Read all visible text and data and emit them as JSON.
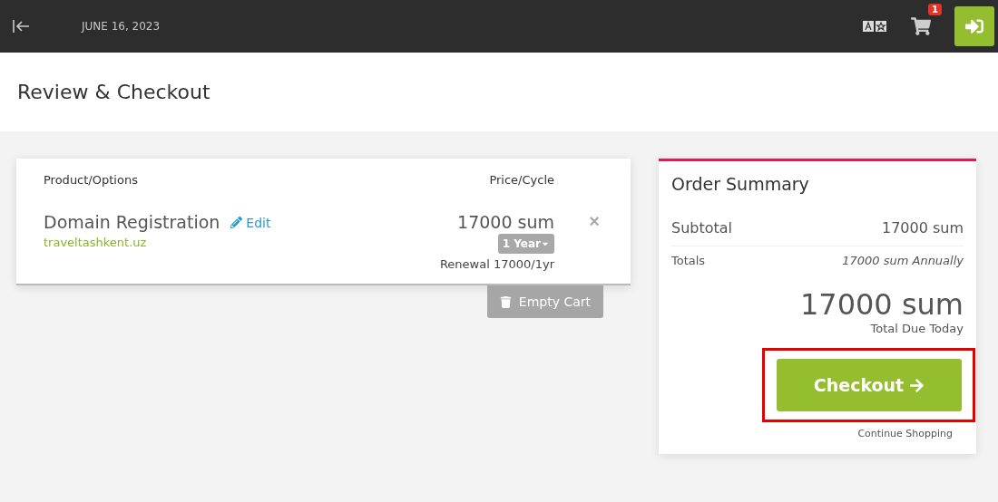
{
  "topbar": {
    "date": "JUNE 16, 2023",
    "cart_count": "1"
  },
  "page_title": "Review & Checkout",
  "cart": {
    "columns": [
      "Product/Options",
      "Price/Cycle"
    ],
    "items": [
      {
        "name": "Domain Registration",
        "edit": "Edit",
        "domain": "traveltashkent.uz",
        "price": "17000 sum",
        "cycle": "1 Year",
        "renewal": "Renewal 17000/1yr",
        "remove": "×"
      }
    ],
    "empty_button": "Empty Cart"
  },
  "summary": {
    "title": "Order Summary",
    "subtotal_label": "Subtotal",
    "subtotal": "17000 sum",
    "totals_label": "Totals",
    "totals": "17000 sum Annually",
    "total_due": "17000 sum",
    "total_due_label": "Total Due Today",
    "checkout": {
      "label": "Checkout",
      "highlighted": true
    },
    "continue": "Continue Shopping"
  }
}
